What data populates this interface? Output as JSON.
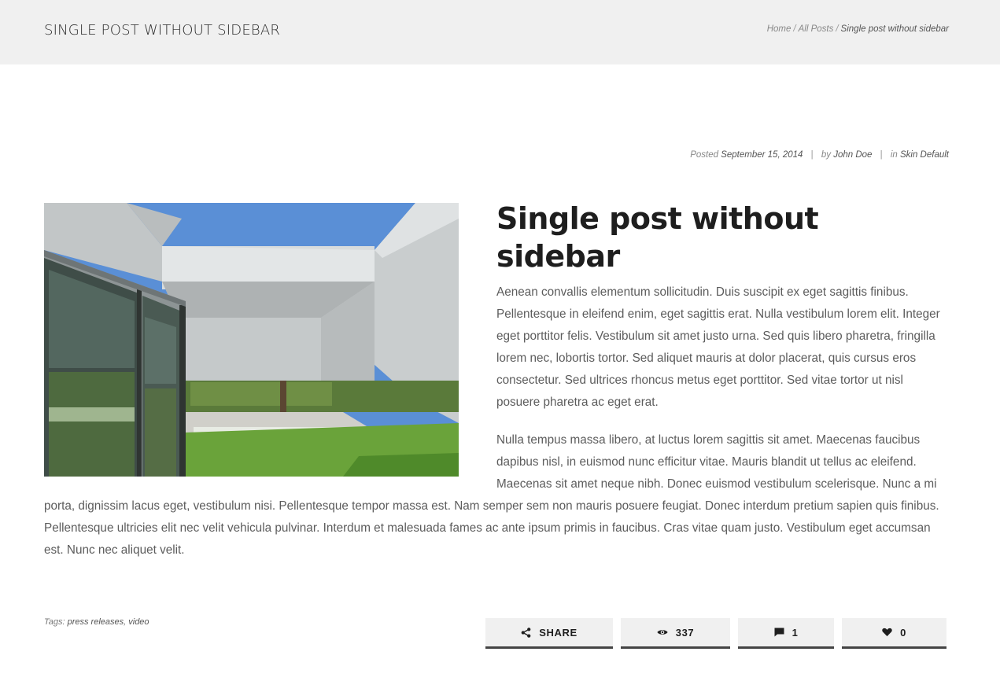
{
  "header": {
    "title": "SINGLE POST WITHOUT SIDEBAR",
    "breadcrumb": {
      "home": "Home",
      "all_posts": "All Posts",
      "current": "Single post without sidebar",
      "separator": "/"
    }
  },
  "meta": {
    "posted_label": "Posted",
    "date": "September 15, 2014",
    "by_label": "by",
    "author": "John Doe",
    "in_label": "in",
    "category": "Skin Default",
    "divider": "|"
  },
  "post": {
    "title": "Single post without sidebar",
    "paragraphs": [
      "Aenean convallis elementum sollicitudin. Duis suscipit ex eget sagittis finibus. Pellentesque in eleifend enim, eget sagittis erat. Nulla vestibulum lorem elit. Integer eget porttitor felis. Vestibulum sit amet justo urna. Sed quis libero pharetra, fringilla lorem nec, lobortis tortor. Sed aliquet mauris at dolor placerat, quis cursus eros consectetur. Sed ultrices rhoncus metus eget porttitor. Sed vitae tortor ut nisl posuere pharetra ac eget erat.",
      "Nulla tempus massa libero, at luctus lorem sagittis sit amet. Maecenas faucibus dapibus nisl, in euismod nunc efficitur vitae. Mauris blandit ut tellus ac eleifend. Maecenas sit amet neque nibh. Donec euismod vestibulum scelerisque. Nunc a mi porta, dignissim lacus eget, vestibulum nisi. Pellentesque tempor massa est. Nam semper sem non mauris posuere feugiat. Donec interdum pretium sapien quis finibus. Pellentesque ultricies elit nec velit vehicula pulvinar. Interdum et malesuada fames ac ante ipsum primis in faucibus. Cras vitae quam justo. Vestibulum eget accumsan est. Nunc nec aliquet velit."
    ]
  },
  "tags": {
    "label": "Tags:",
    "items": [
      "press releases",
      "video"
    ],
    "separator": ","
  },
  "actions": {
    "share": {
      "label": "SHARE",
      "icon": "share-icon"
    },
    "views": {
      "count": "337",
      "icon": "eye-icon"
    },
    "comments": {
      "count": "1",
      "icon": "comment-icon"
    },
    "likes": {
      "count": "0",
      "icon": "heart-icon"
    }
  },
  "colors": {
    "header_bg": "#f0f0f0",
    "title": "#1e1e1e",
    "body_text": "#5c5c5c",
    "action_bg": "#f0f0f0",
    "action_border": "#444444"
  }
}
